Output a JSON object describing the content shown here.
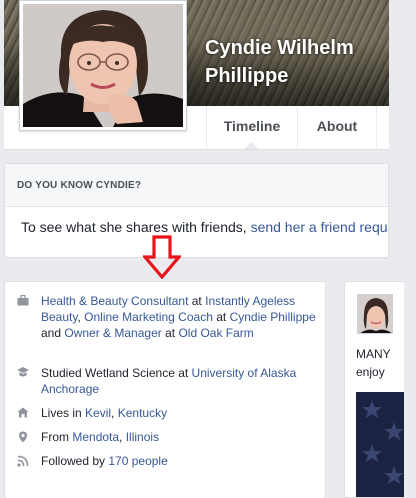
{
  "profile": {
    "name_line1": "Cyndie Wilhelm",
    "name_line2": "Phillippe"
  },
  "tabs": [
    {
      "label": "Timeline",
      "active": true
    },
    {
      "label": "About",
      "active": false
    }
  ],
  "know_card": {
    "heading": "DO YOU KNOW CYNDIE?",
    "text": "To see what she shares with friends, ",
    "link": "send her a friend requ"
  },
  "intro": {
    "work": {
      "link1": "Health & Beauty Consultant",
      "at1": " at ",
      "link2": "Instantly Ageless Beauty",
      "sep1": ", ",
      "link3": "Online Marketing Coach",
      "at2": " at ",
      "link4": "Cyndie Phillippe",
      "and": " and ",
      "link5": "Owner & Manager",
      "at3": " at ",
      "link6": "Old Oak Farm"
    },
    "education": {
      "prefix": "Studied Wetland Science at ",
      "link": "University of Alaska Anchorage"
    },
    "lives": {
      "prefix": "Lives in ",
      "link1": "Kevil",
      "sep": ", ",
      "link2": "Kentucky"
    },
    "from": {
      "prefix": "From ",
      "link1": "Mendota",
      "sep": ", ",
      "link2": "Illinois"
    },
    "followers": {
      "prefix": "Followed by ",
      "link": "170 people"
    }
  },
  "post": {
    "line1": "MANY",
    "line2": "enjoy"
  },
  "colors": {
    "link": "#365899",
    "background": "#e9ebee",
    "arrow": "#e8141b"
  }
}
